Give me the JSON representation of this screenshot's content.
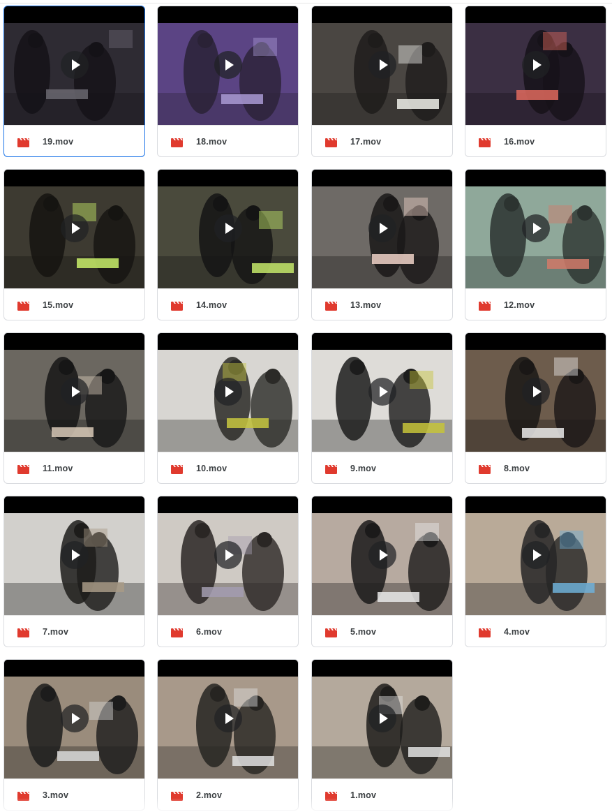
{
  "files": [
    {
      "name": "19.mov",
      "bg": "#2e2b33",
      "fg": "#141217",
      "accent": "#6a6770",
      "selected": true
    },
    {
      "name": "18.mov",
      "bg": "#5b4484",
      "fg": "#2a2236",
      "accent": "#a99ad4",
      "selected": false
    },
    {
      "name": "17.mov",
      "bg": "#4a4642",
      "fg": "#1e1c1b",
      "accent": "#f0f0ea",
      "selected": false
    },
    {
      "name": "16.mov",
      "bg": "#3b2f43",
      "fg": "#161219",
      "accent": "#e06a5e",
      "selected": false
    },
    {
      "name": "15.mov",
      "bg": "#3d3a31",
      "fg": "#151411",
      "accent": "#c9f06a",
      "selected": false
    },
    {
      "name": "14.mov",
      "bg": "#4a4a3c",
      "fg": "#141414",
      "accent": "#c4e86a",
      "selected": false
    },
    {
      "name": "13.mov",
      "bg": "#6e6a66",
      "fg": "#1a1818",
      "accent": "#f0d2c8",
      "selected": false
    },
    {
      "name": "12.mov",
      "bg": "#8fa89a",
      "fg": "#2c3330",
      "accent": "#d27a6a",
      "selected": false
    },
    {
      "name": "11.mov",
      "bg": "#6b6760",
      "fg": "#161616",
      "accent": "#d8c9b7",
      "selected": false
    },
    {
      "name": "10.mov",
      "bg": "#d8d6d2",
      "fg": "#2b2a27",
      "accent": "#c8c840",
      "selected": false
    },
    {
      "name": "9.mov",
      "bg": "#dedcd8",
      "fg": "#1c1c1c",
      "accent": "#c6c33a",
      "selected": false
    },
    {
      "name": "8.mov",
      "bg": "#6d5c4c",
      "fg": "#1a1716",
      "accent": "#eaeaea",
      "selected": false
    },
    {
      "name": "7.mov",
      "bg": "#d2d0cc",
      "fg": "#1d1c1a",
      "accent": "#a89a86",
      "selected": false
    },
    {
      "name": "6.mov",
      "bg": "#cfcac4",
      "fg": "#2a2624",
      "accent": "#a39cb0",
      "selected": false
    },
    {
      "name": "5.mov",
      "bg": "#b7aaa0",
      "fg": "#1b1a1a",
      "accent": "#e8e8e8",
      "selected": false
    },
    {
      "name": "4.mov",
      "bg": "#b9aa98",
      "fg": "#262626",
      "accent": "#6fb0d8",
      "selected": false
    },
    {
      "name": "3.mov",
      "bg": "#9a8c7c",
      "fg": "#1c1c1c",
      "accent": "#d8d8d8",
      "selected": false
    },
    {
      "name": "2.mov",
      "bg": "#a8998a",
      "fg": "#262421",
      "accent": "#e0e0e0",
      "selected": false
    },
    {
      "name": "1.mov",
      "bg": "#b4a99c",
      "fg": "#1e1d1b",
      "accent": "#e2e2e2",
      "selected": false
    }
  ],
  "icons": {
    "file_type": "video-file-icon",
    "play": "play-icon"
  },
  "colors": {
    "video_icon": "#e03a2e",
    "selection_border": "#1a73e8"
  }
}
